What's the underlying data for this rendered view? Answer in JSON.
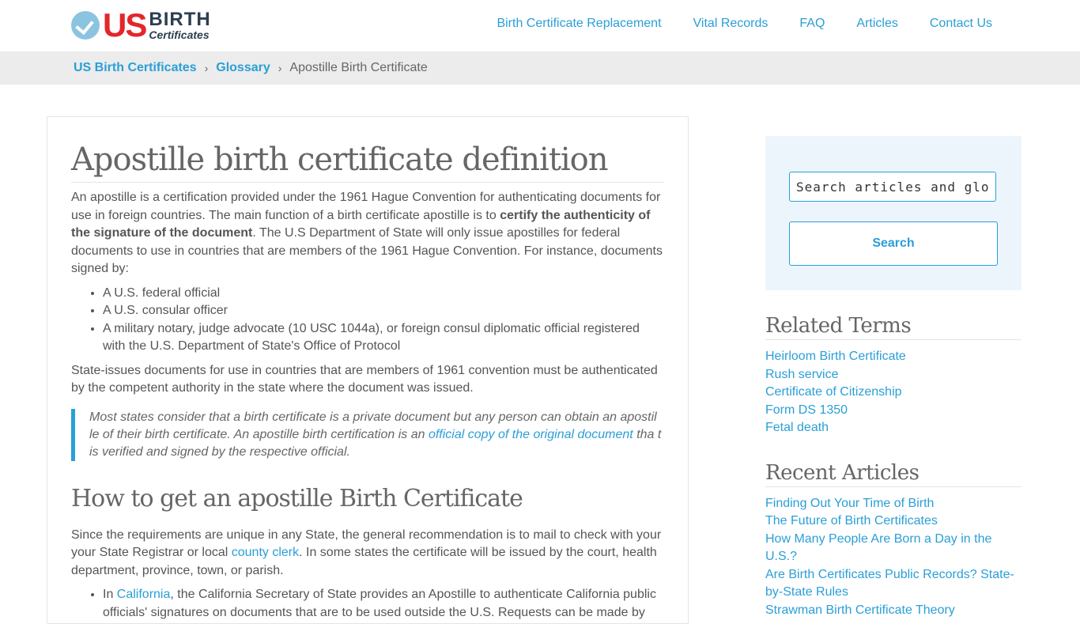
{
  "logo": {
    "us": "US",
    "birth": "BIRTH",
    "certificates": "Certificates"
  },
  "nav": [
    "Birth Certificate Replacement",
    "Vital Records",
    "FAQ",
    "Articles",
    "Contact Us"
  ],
  "breadcrumb": {
    "home": "US Birth Certificates",
    "section": "Glossary",
    "current": "Apostille Birth Certificate",
    "separator": "›"
  },
  "article": {
    "title": "Apostille birth certificate definition",
    "p1_a": "An apostille is a certification provided under the 1961 Hague Convention for authenticating documents for use in foreign countries. The main function of a birth certificate apostille is to ",
    "p1_bold": "certify the authenticity of the signature of the document",
    "p1_b": ". The U.S Department of State will only issue apostilles for federal documents to use in countries that are members of the 1961 Hague Convention. For instance, documents signed by:",
    "list1": [
      "A U.S. federal official",
      "A U.S. consular officer",
      "A military notary, judge advocate (10 USC 1044a), or foreign consul diplomatic official registered with the U.S. Department of State's Office of Protocol"
    ],
    "p2": "State-issues documents for use in countries that are members of 1961 convention must be authenticated by the competent authority in the state where the document was issued.",
    "quote_a": "Most states consider that a birth certificate is a private document but any person can obtain an apostil le of their birth certificate. An apostille birth certification is an ",
    "quote_link": "official copy of the original document",
    "quote_b": " tha t is verified and signed by the respective official.",
    "h2": "How to get an apostille Birth Certificate",
    "p3_a": "Since the requirements are unique in any State, the general recommendation is to mail to check with your your State Registrar or local ",
    "p3_link": "county clerk",
    "p3_b": ". In some states the certificate will be issued by the court, health department, province, town, or parish.",
    "li_a": "In ",
    "li_link": "California",
    "li_b": ", the California Secretary of State provides an Apostille to authenticate California public officials' signatures on documents that are to be used outside the U.S. Requests can be made by"
  },
  "search": {
    "placeholder": "Search articles and glossary",
    "button": "Search"
  },
  "related": {
    "heading": "Related Terms",
    "items": [
      "Heirloom Birth Certificate",
      "Rush service",
      "Certificate of Citizenship",
      "Form DS 1350",
      "Fetal death"
    ]
  },
  "recent": {
    "heading": "Recent Articles",
    "items": [
      "Finding Out Your Time of Birth",
      "The Future of Birth Certificates",
      "How Many People Are Born a Day in the U.S.?",
      "Are Birth Certificates Public Records? State-by-State Rules",
      "Strawman Birth Certificate Theory"
    ]
  }
}
